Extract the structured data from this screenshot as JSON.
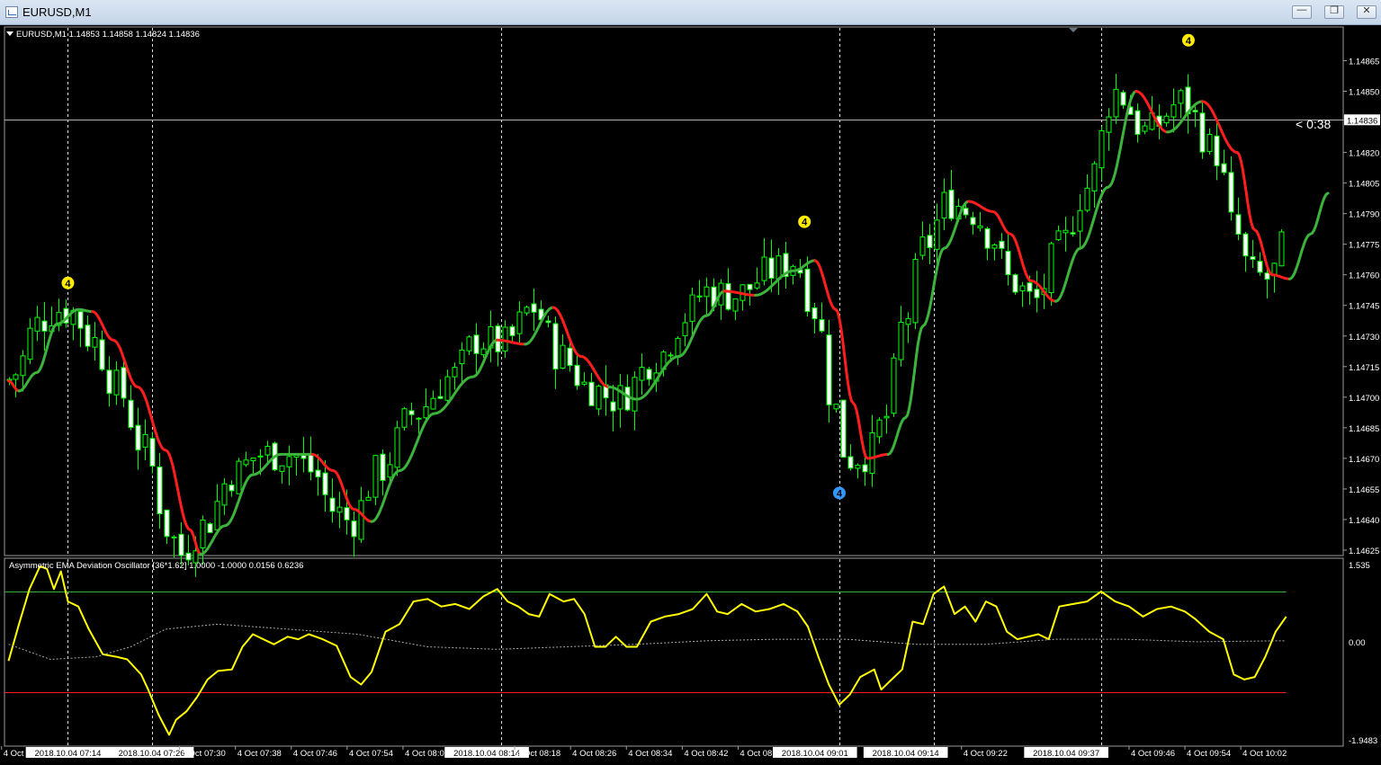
{
  "window": {
    "title": "EURUSD,M1",
    "buttons": [
      "minimize",
      "restore",
      "close"
    ]
  },
  "main_panel": {
    "symbol_info": "EURUSD,M1  1.14853 1.14858 1.14824 1.14836",
    "current_price_label": "1.14836",
    "countdown": "< 0:38"
  },
  "sub_panel": {
    "info": "Asymmetric EMA Deviation Oscillator [36*1.62] 1.0000 -1.0000 0.0156 0.6236"
  },
  "colors": {
    "background": "#000000",
    "bull_candle": "#00ff00",
    "bear_candle": "#ffffff",
    "ma_up": "#3cb43c",
    "ma_down": "#ff1e1e",
    "oscillator": "#ffff00",
    "upper_level": "#3cb43c",
    "lower_level": "#ff1e1e",
    "grid_vertical": "#ffffff",
    "axis_text": "#ffffff"
  },
  "chart_data": [
    {
      "type": "candlestick",
      "symbol": "EURUSD",
      "timeframe": "M1",
      "ylim": [
        1.14625,
        1.14878
      ],
      "y_ticks": [
        "1.14865",
        "1.14850",
        "1.14836",
        "1.14820",
        "1.14805",
        "1.14790",
        "1.14775",
        "1.14760",
        "1.14745",
        "1.14730",
        "1.14715",
        "1.14700",
        "1.14685",
        "1.14670",
        "1.14655",
        "1.14640",
        "1.14625"
      ],
      "current_price": 1.14836,
      "candle_count": 178,
      "ma_line": {
        "name": "",
        "up_color": "#3cb43c",
        "down_color": "#ff1e1e",
        "points": [
          [
            0,
            1.14708,
            "down"
          ],
          [
            3,
            1.14703,
            "up"
          ],
          [
            8,
            1.14712,
            "up"
          ],
          [
            14,
            1.14736,
            "up"
          ],
          [
            20,
            1.14743,
            "up"
          ],
          [
            24,
            1.14742,
            "down"
          ],
          [
            30,
            1.14728,
            "down"
          ],
          [
            37,
            1.14705,
            "down"
          ],
          [
            45,
            1.14674,
            "down"
          ],
          [
            52,
            1.14635,
            "down"
          ],
          [
            55,
            1.14623,
            "up"
          ],
          [
            62,
            1.14637,
            "up"
          ],
          [
            70,
            1.14662,
            "up"
          ],
          [
            78,
            1.14672,
            "up"
          ],
          [
            87,
            1.14672,
            "down"
          ],
          [
            93,
            1.14664,
            "down"
          ],
          [
            99,
            1.14645,
            "down"
          ],
          [
            104,
            1.14639,
            "up"
          ],
          [
            112,
            1.14664,
            "up"
          ],
          [
            122,
            1.14692,
            "up"
          ],
          [
            133,
            1.1471,
            "up"
          ],
          [
            140,
            1.14728,
            "down"
          ],
          [
            148,
            1.14726,
            "up"
          ],
          [
            156,
            1.14744,
            "down"
          ],
          [
            164,
            1.1472,
            "down"
          ],
          [
            172,
            1.14705,
            "up"
          ],
          [
            180,
            1.14699,
            "up"
          ],
          [
            192,
            1.1472,
            "up"
          ],
          [
            200,
            1.1474,
            "up"
          ],
          [
            205,
            1.14752,
            "down"
          ],
          [
            214,
            1.1475,
            "up"
          ],
          [
            225,
            1.14762,
            "up"
          ],
          [
            231,
            1.14767,
            "down"
          ],
          [
            237,
            1.14743,
            "down"
          ],
          [
            242,
            1.14697,
            "down"
          ],
          [
            246,
            1.1467,
            "down"
          ],
          [
            252,
            1.14672,
            "up"
          ],
          [
            257,
            1.1469,
            "up"
          ],
          [
            262,
            1.14735,
            "up"
          ],
          [
            268,
            1.14773,
            "up"
          ],
          [
            275,
            1.14796,
            "down"
          ],
          [
            282,
            1.14791,
            "down"
          ],
          [
            287,
            1.1478,
            "down"
          ],
          [
            293,
            1.14757,
            "down"
          ],
          [
            300,
            1.14747,
            "up"
          ],
          [
            307,
            1.14773,
            "up"
          ],
          [
            315,
            1.14803,
            "up"
          ],
          [
            323,
            1.1485,
            "down"
          ],
          [
            332,
            1.1483,
            "up"
          ],
          [
            342,
            1.14845,
            "down"
          ],
          [
            352,
            1.1482,
            "down"
          ],
          [
            357,
            1.14782,
            "down"
          ],
          [
            362,
            1.1476,
            "down"
          ],
          [
            367,
            1.14758,
            "up"
          ],
          [
            373,
            1.1478,
            "up"
          ],
          [
            378,
            1.148,
            "up"
          ]
        ]
      },
      "markers": [
        {
          "label": "4",
          "candle": 17,
          "price": 1.14756,
          "color": "#ffeb00",
          "position": "above"
        },
        {
          "label": "4",
          "candle": 228,
          "price": 1.14786,
          "color": "#ffeb00",
          "position": "above"
        },
        {
          "label": "4",
          "candle": 238,
          "price": 1.14653,
          "color": "#3296ff",
          "position": "below"
        },
        {
          "label": "4",
          "candle": 338,
          "price": 1.14875,
          "color": "#ffeb00",
          "position": "above"
        }
      ],
      "vertical_lines_candle": [
        17,
        41,
        141,
        238,
        265,
        313
      ]
    },
    {
      "type": "line",
      "title": "Asymmetric EMA Deviation Oscillator [36*1.62]",
      "ylim": [
        -1.9483,
        1.535
      ],
      "y_ticks": [
        "1.535",
        "0.00",
        "-1.9483"
      ],
      "levels": [
        {
          "value": 1.0,
          "color": "#3cb43c"
        },
        {
          "value": -1.0,
          "color": "#ff1e1e"
        }
      ],
      "series": [
        {
          "name": "",
          "color": "#ffff00",
          "points": [
            [
              0,
              -0.38
            ],
            [
              3,
              0.35
            ],
            [
              6,
              1.05
            ],
            [
              9,
              1.5
            ],
            [
              11,
              1.45
            ],
            [
              13,
              1.05
            ],
            [
              15,
              1.4
            ],
            [
              17,
              0.8
            ],
            [
              20,
              0.7
            ],
            [
              23,
              0.25
            ],
            [
              27,
              -0.25
            ],
            [
              31,
              -0.3
            ],
            [
              34,
              -0.35
            ],
            [
              38,
              -0.65
            ],
            [
              40,
              -0.95
            ],
            [
              43,
              -1.45
            ],
            [
              46,
              -1.85
            ],
            [
              48,
              -1.55
            ],
            [
              51,
              -1.38
            ],
            [
              54,
              -1.1
            ],
            [
              57,
              -0.75
            ],
            [
              60,
              -0.58
            ],
            [
              64,
              -0.55
            ],
            [
              67,
              -0.1
            ],
            [
              70,
              0.15
            ],
            [
              73,
              0.05
            ],
            [
              76,
              -0.05
            ],
            [
              80,
              0.1
            ],
            [
              83,
              0.05
            ],
            [
              86,
              0.15
            ],
            [
              90,
              0.05
            ],
            [
              94,
              -0.08
            ],
            [
              98,
              -0.7
            ],
            [
              101,
              -0.85
            ],
            [
              104,
              -0.6
            ],
            [
              108,
              0.2
            ],
            [
              112,
              0.35
            ],
            [
              116,
              0.8
            ],
            [
              120,
              0.85
            ],
            [
              124,
              0.7
            ],
            [
              128,
              0.75
            ],
            [
              132,
              0.65
            ],
            [
              136,
              0.9
            ],
            [
              140,
              1.05
            ],
            [
              143,
              0.8
            ],
            [
              146,
              0.7
            ],
            [
              149,
              0.55
            ],
            [
              152,
              0.5
            ],
            [
              155,
              0.95
            ],
            [
              159,
              0.8
            ],
            [
              162,
              0.85
            ],
            [
              165,
              0.55
            ],
            [
              168,
              -0.1
            ],
            [
              171,
              -0.1
            ],
            [
              174,
              0.1
            ],
            [
              177,
              -0.1
            ],
            [
              180,
              -0.1
            ],
            [
              184,
              0.4
            ],
            [
              188,
              0.5
            ],
            [
              192,
              0.55
            ],
            [
              196,
              0.65
            ],
            [
              200,
              0.95
            ],
            [
              203,
              0.6
            ],
            [
              206,
              0.55
            ],
            [
              210,
              0.75
            ],
            [
              214,
              0.6
            ],
            [
              218,
              0.65
            ],
            [
              222,
              0.75
            ],
            [
              226,
              0.6
            ],
            [
              229,
              0.3
            ],
            [
              232,
              -0.3
            ],
            [
              235,
              -0.85
            ],
            [
              238,
              -1.25
            ],
            [
              241,
              -1.05
            ],
            [
              244,
              -0.7
            ],
            [
              248,
              -0.55
            ],
            [
              250,
              -0.95
            ],
            [
              253,
              -0.75
            ],
            [
              256,
              -0.55
            ],
            [
              259,
              0.4
            ],
            [
              262,
              0.35
            ],
            [
              265,
              0.95
            ],
            [
              268,
              1.1
            ],
            [
              271,
              0.55
            ],
            [
              274,
              0.7
            ],
            [
              277,
              0.4
            ],
            [
              280,
              0.8
            ],
            [
              283,
              0.7
            ],
            [
              286,
              0.2
            ],
            [
              289,
              0.05
            ],
            [
              292,
              0.1
            ],
            [
              295,
              0.15
            ],
            [
              298,
              0.05
            ],
            [
              301,
              0.7
            ],
            [
              305,
              0.75
            ],
            [
              309,
              0.8
            ],
            [
              313,
              1.0
            ],
            [
              317,
              0.8
            ],
            [
              321,
              0.7
            ],
            [
              325,
              0.5
            ],
            [
              329,
              0.65
            ],
            [
              333,
              0.7
            ],
            [
              337,
              0.6
            ],
            [
              340,
              0.45
            ],
            [
              344,
              0.2
            ],
            [
              348,
              0.05
            ],
            [
              351,
              -0.65
            ],
            [
              354,
              -0.75
            ],
            [
              357,
              -0.7
            ],
            [
              360,
              -0.3
            ],
            [
              363,
              0.2
            ],
            [
              366,
              0.5
            ]
          ]
        },
        {
          "name": "",
          "color": "#aaaaaa",
          "dashed": true,
          "points": [
            [
              0,
              -0.05
            ],
            [
              12,
              -0.35
            ],
            [
              25,
              -0.3
            ],
            [
              35,
              -0.1
            ],
            [
              45,
              0.25
            ],
            [
              60,
              0.35
            ],
            [
              80,
              0.25
            ],
            [
              100,
              0.15
            ],
            [
              120,
              -0.1
            ],
            [
              140,
              -0.15
            ],
            [
              160,
              -0.1
            ],
            [
              180,
              -0.05
            ],
            [
              200,
              0.02
            ],
            [
              220,
              0.05
            ],
            [
              240,
              0.05
            ],
            [
              260,
              -0.05
            ],
            [
              280,
              -0.05
            ],
            [
              300,
              0.05
            ],
            [
              320,
              0.05
            ],
            [
              340,
              0.0
            ],
            [
              366,
              0.02
            ]
          ]
        }
      ]
    }
  ],
  "x_axis": {
    "labels": [
      {
        "text": "4 Oct",
        "candle": -2,
        "style": "plain"
      },
      {
        "text": "2018.10.04 07:14",
        "candle": 17,
        "style": "highlight"
      },
      {
        "text": "2018.10.04 07:26",
        "candle": 41,
        "style": "highlight"
      },
      {
        "text": "4 Oct 07:30",
        "candle": 49,
        "style": "plain"
      },
      {
        "text": "4 Oct 07:38",
        "candle": 65,
        "style": "plain"
      },
      {
        "text": "4 Oct 07:46",
        "candle": 81,
        "style": "plain"
      },
      {
        "text": "4 Oct 07:54",
        "candle": 97,
        "style": "plain"
      },
      {
        "text": "4 Oct 08:02",
        "candle": 113,
        "style": "plain"
      },
      {
        "text": "2018.10.04 08:14",
        "candle": 137,
        "style": "highlight"
      },
      {
        "text": "4 Oct 08:18",
        "candle": 145,
        "style": "plain"
      },
      {
        "text": "4 Oct 08:26",
        "candle": 161,
        "style": "plain"
      },
      {
        "text": "4 Oct 08:34",
        "candle": 177,
        "style": "plain"
      },
      {
        "text": "4 Oct 08:42",
        "candle": 193,
        "style": "plain"
      },
      {
        "text": "4 Oct 08:50",
        "candle": 209,
        "style": "plain"
      },
      {
        "text": "2018.10.04 09:01",
        "candle": 231,
        "style": "highlight"
      },
      {
        "text": "2018.10.04 09:14",
        "candle": 257,
        "style": "highlight"
      },
      {
        "text": "4 Oct 09:22",
        "candle": 273,
        "style": "plain"
      },
      {
        "text": "2018.10.04 09:37",
        "candle": 303,
        "style": "highlight"
      },
      {
        "text": "4 Oct 09:46",
        "candle": 321,
        "style": "plain"
      },
      {
        "text": "4 Oct 09:54",
        "candle": 337,
        "style": "plain"
      },
      {
        "text": "4 Oct 10:02",
        "candle": 353,
        "style": "plain"
      }
    ]
  }
}
